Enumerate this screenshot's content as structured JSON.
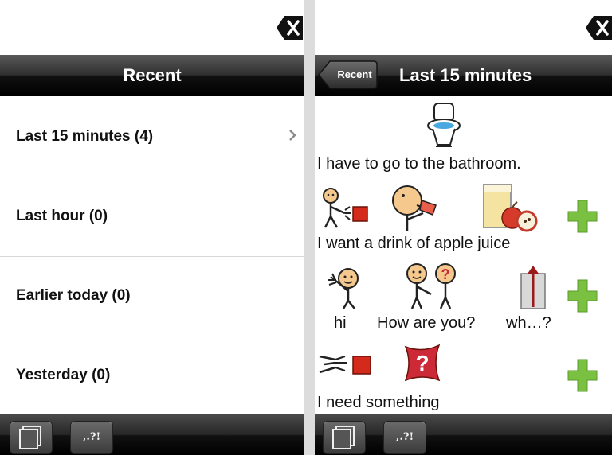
{
  "left_panel": {
    "nav": {
      "title": "Recent"
    },
    "rows": [
      {
        "label": "Last 15 minutes (4)"
      },
      {
        "label": "Last hour (0)"
      },
      {
        "label": "Earlier today (0)"
      },
      {
        "label": "Yesterday (0)"
      }
    ],
    "toolbar": {
      "punct_label": ",.?!"
    }
  },
  "right_panel": {
    "nav": {
      "title": "Last 15 minutes",
      "back_label": "Recent"
    },
    "phrases": [
      {
        "text": "I have to go to the bathroom."
      },
      {
        "text": "I want a drink of apple juice"
      },
      {
        "words": [
          "hi",
          "How are you?",
          "wh…?"
        ]
      },
      {
        "text": "I need something"
      }
    ],
    "toolbar": {
      "punct_label": ",.?!"
    }
  },
  "icons": [
    "clear-icon",
    "chevron-right-icon",
    "copy-icon",
    "plus-icon",
    "toilet-icon",
    "want-icon",
    "drink-icon",
    "apple-juice-icon",
    "hi-icon",
    "how-are-you-icon",
    "question-icon",
    "need-icon",
    "something-icon"
  ],
  "colors": {
    "plus_green": "#7ac142",
    "nav_bar": "#000000",
    "question_red": "#cc2a36"
  }
}
